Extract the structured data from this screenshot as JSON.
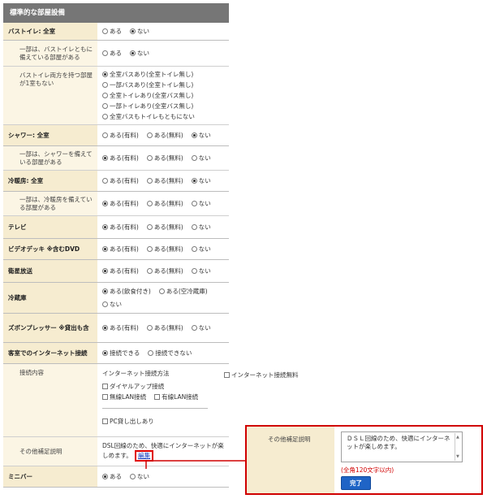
{
  "panel_title": "標準的な部屋設備",
  "rows": {
    "bath": {
      "label": "バストイレ: 全室",
      "opts": [
        "ある",
        "ない"
      ],
      "sel": 1
    },
    "bath_sub": {
      "label": "一部は、バストイレともに備えている部屋がある",
      "opts": [
        "ある",
        "ない"
      ],
      "sel": 1
    },
    "bath_sep": {
      "label": "バストイレ両方を持つ部屋が1室もない",
      "opts": [
        "全室バスあり(全室トイレ無し)",
        "一部バスあり(全室トイレ無し)",
        "全室トイレあり(全室バス無し)",
        "一部トイレあり(全室バス無し)",
        "全室バスもトイレもともにない"
      ],
      "sel": 0
    },
    "shower": {
      "label": "シャワー: 全室",
      "opts": [
        "ある(有料)",
        "ある(無料)",
        "ない"
      ],
      "sel": 2
    },
    "shower_sub": {
      "label": "一部は、シャワーを備えている部屋がある",
      "opts": [
        "ある(有料)",
        "ある(無料)",
        "ない"
      ],
      "sel": 0
    },
    "ac": {
      "label": "冷暖房: 全室",
      "opts": [
        "ある(有料)",
        "ある(無料)",
        "ない"
      ],
      "sel": 2
    },
    "ac_sub": {
      "label": "一部は、冷暖房を備えている部屋がある",
      "opts": [
        "ある(有料)",
        "ある(無料)",
        "ない"
      ],
      "sel": 0
    },
    "tv": {
      "label": "テレビ",
      "opts": [
        "ある(有料)",
        "ある(無料)",
        "ない"
      ],
      "sel": 0
    },
    "video": {
      "label": "ビデオデッキ ※含むDVD",
      "opts": [
        "ある(有料)",
        "ある(無料)",
        "ない"
      ],
      "sel": 0
    },
    "sat": {
      "label": "衛星放送",
      "opts": [
        "ある(有料)",
        "ある(無料)",
        "ない"
      ],
      "sel": 0
    },
    "fridge": {
      "label": "冷蔵庫",
      "opts": [
        "ある(飲食付き)",
        "ある(空冷蔵庫)",
        "ない"
      ],
      "sel": 0
    },
    "press": {
      "label": "ズボンプレッサー ※貸出も含",
      "opts": [
        "ある(有料)",
        "ある(無料)",
        "ない"
      ],
      "sel": 0
    },
    "net": {
      "label": "客室でのインターネット接続",
      "opts": [
        "接続できる",
        "接続できない"
      ],
      "sel": 0
    },
    "net_detail": {
      "label": "接続内容",
      "method_label": "インターネット接続方法",
      "methods": [
        "ダイヤルアップ接続",
        "無線LAN接続",
        "有線LAN接続"
      ],
      "pc": [
        "PC貸し出しあり",
        "インターネット接続無料"
      ]
    },
    "other": {
      "label": "その他補足説明",
      "text": "DSL回線のため、快適にインターネットが楽しめます。",
      "edit": "編集"
    },
    "minibar": {
      "label": "ミニバー",
      "opts": [
        "ある",
        "ない"
      ],
      "sel": 0
    }
  },
  "callout": {
    "label": "その他補足説明",
    "text": "ＤＳＬ回線のため、快適にインターネットが楽しめます。",
    "note": "(全角120文字以内)",
    "done": "完了"
  },
  "colors": {
    "accent_red": "#d00000",
    "header_gray": "#767676",
    "label_beige": "#f6ecd0",
    "button_blue": "#1f64c6"
  }
}
